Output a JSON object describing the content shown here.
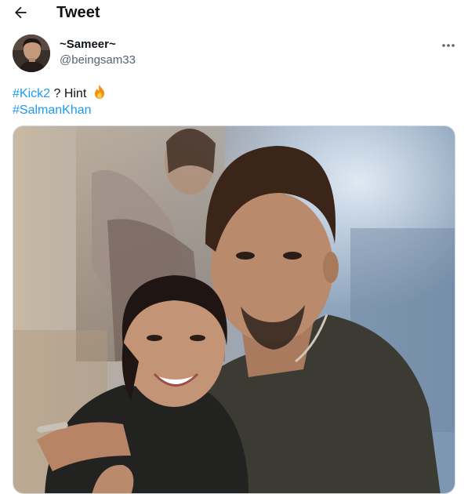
{
  "header": {
    "title": "Tweet",
    "back_icon": "arrow-left-icon"
  },
  "author": {
    "display_name": "~Sameer~",
    "handle": "@beingsam33",
    "avatar_icon": "profile-photo"
  },
  "tweet": {
    "hashtag_1": "#Kick2",
    "middle_text": " ? Hint ",
    "emoji_icon": "fire-emoji-icon",
    "hashtag_2": "#SalmanKhan"
  },
  "more_icon": "more-horizontal-icon",
  "colors": {
    "link": "#1d9bf0",
    "text": "#0f1419",
    "secondary": "#536471",
    "border": "#cfd9de"
  }
}
